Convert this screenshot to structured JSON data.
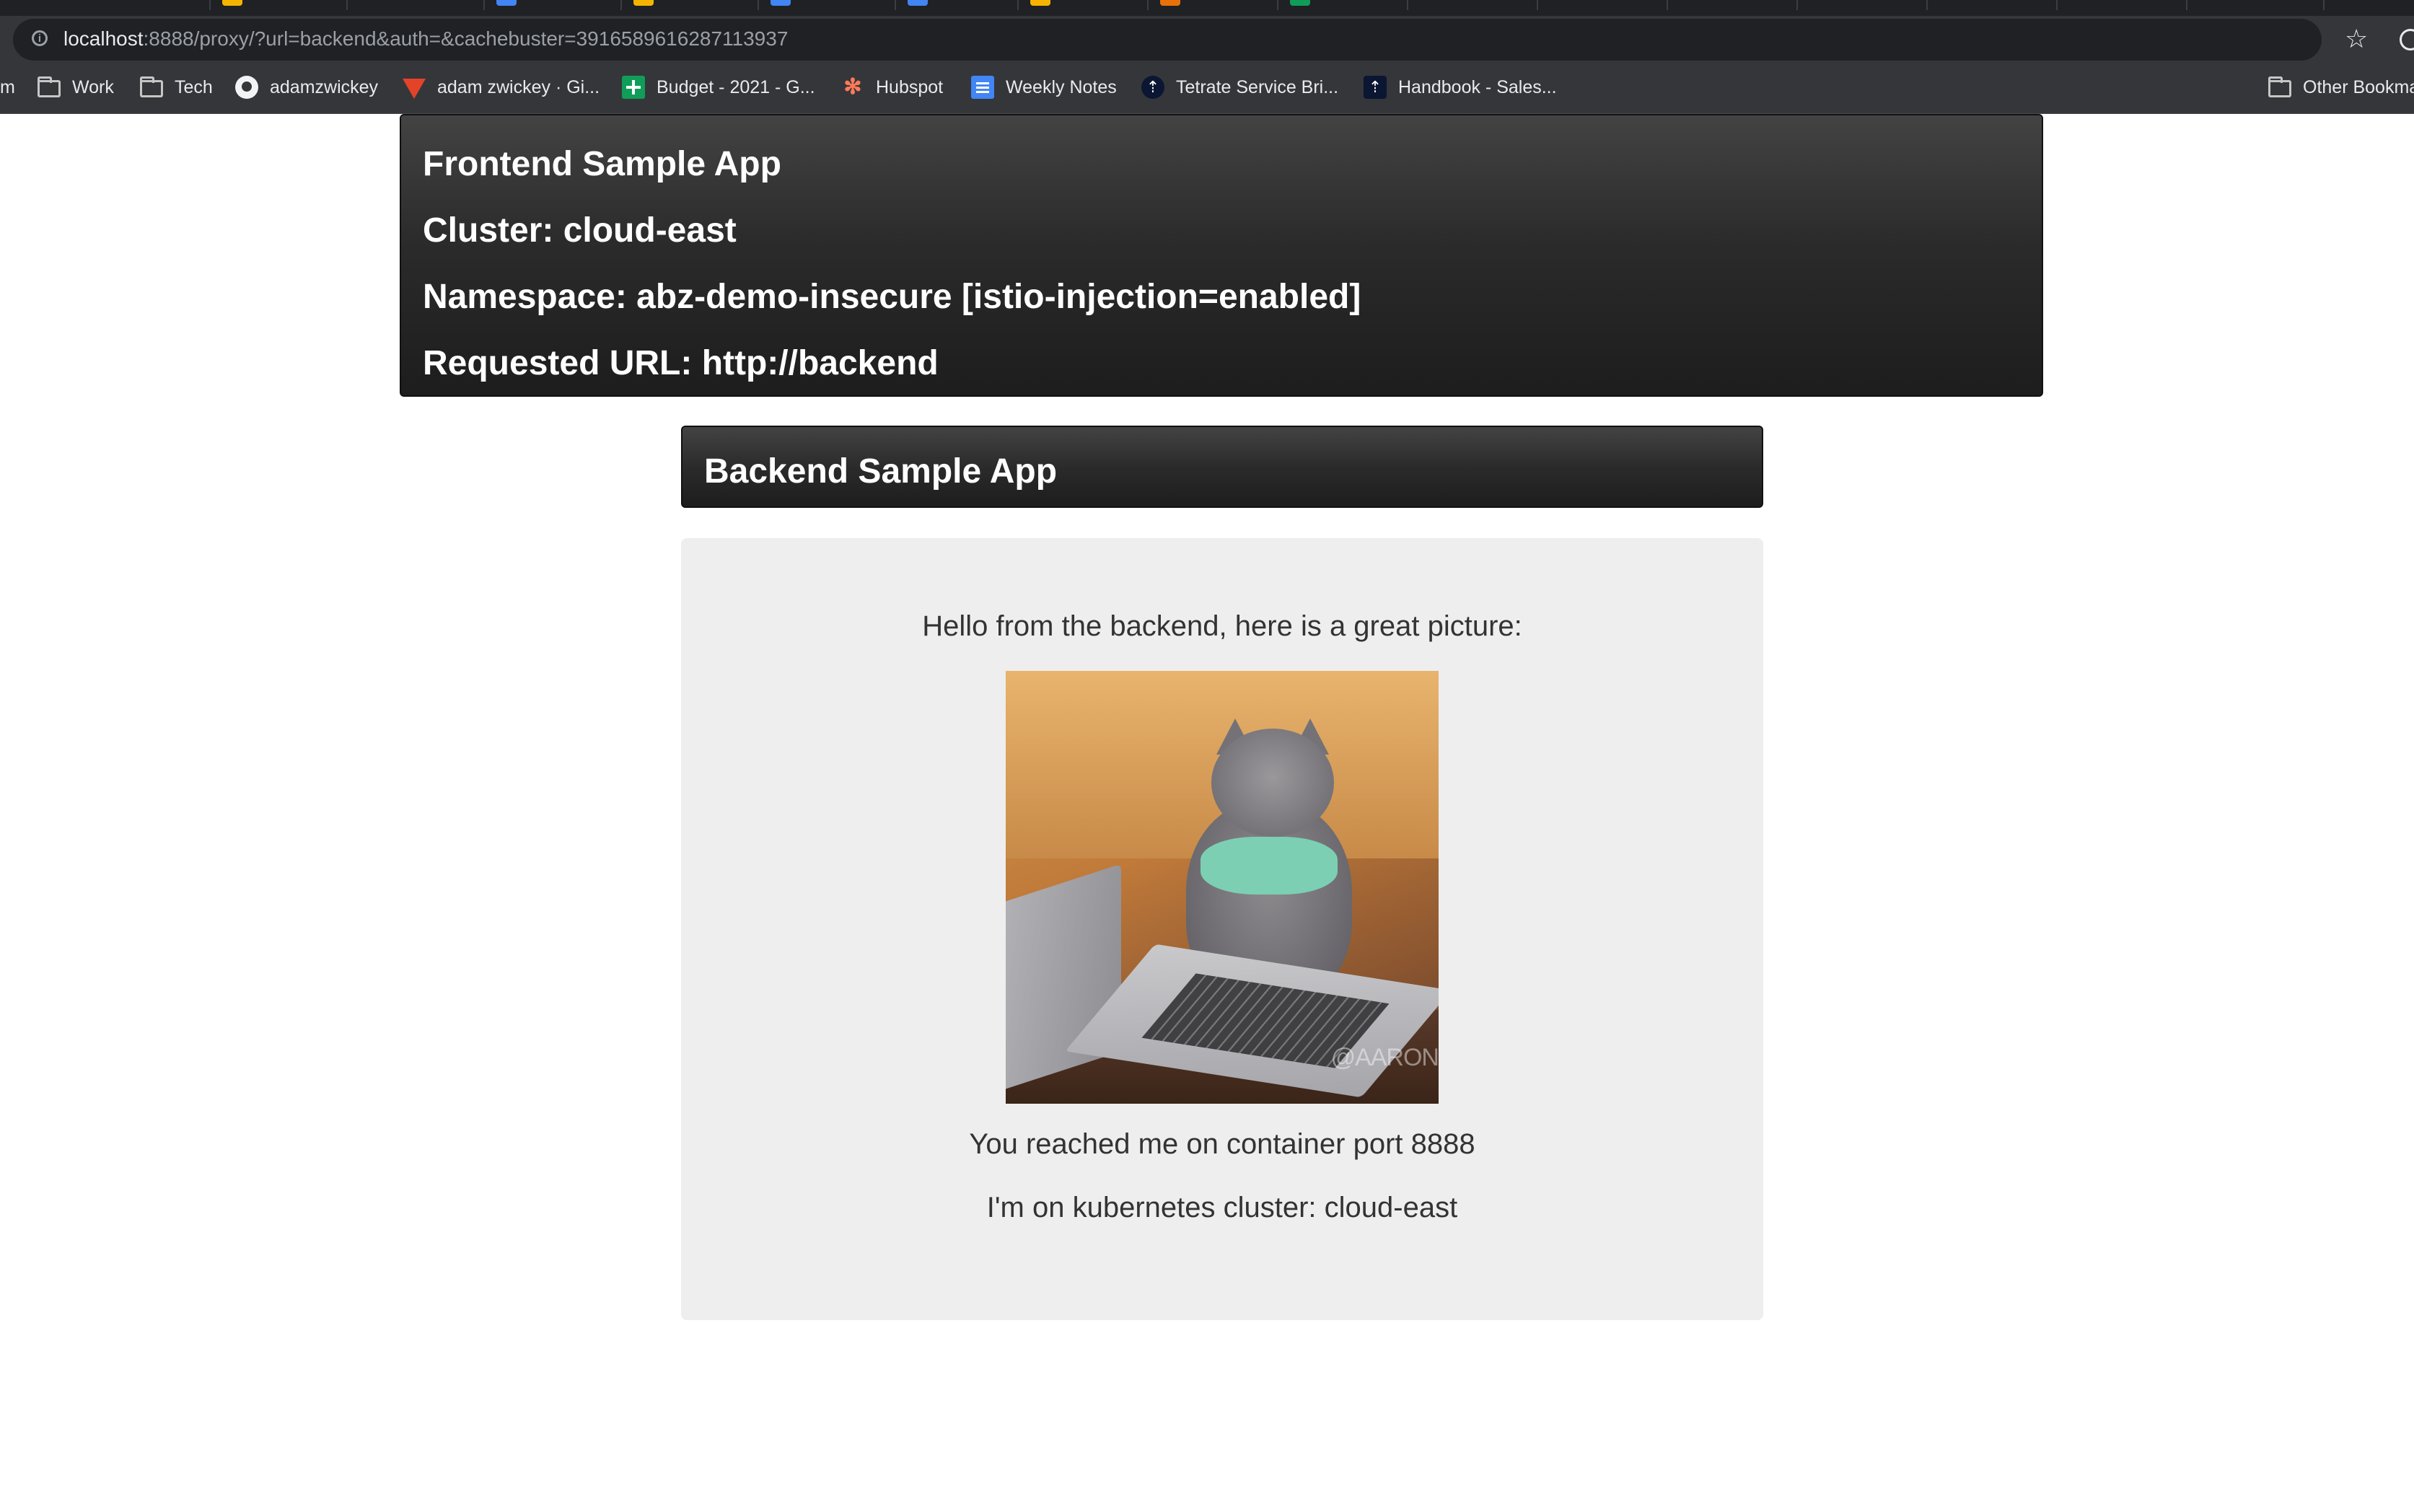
{
  "browser": {
    "url_host": "localhost",
    "url_rest": ":8888/proxy/?url=backend&auth=&cachebuster=3916589616287113937",
    "bookmarks": [
      {
        "label": "m",
        "icon": "none"
      },
      {
        "label": "Work",
        "icon": "folder-icon"
      },
      {
        "label": "Tech",
        "icon": "folder-icon"
      },
      {
        "label": "adamzwickey",
        "icon": "github-icon"
      },
      {
        "label": "adam zwickey · Gi...",
        "icon": "gitlab-icon"
      },
      {
        "label": "Budget - 2021 - G...",
        "icon": "sheets-icon"
      },
      {
        "label": "Hubspot",
        "icon": "hubspot-icon"
      },
      {
        "label": "Weekly Notes",
        "icon": "docs-icon"
      },
      {
        "label": "Tetrate Service Bri...",
        "icon": "tetrate-icon"
      },
      {
        "label": "Handbook - Sales...",
        "icon": "handbook-icon"
      },
      {
        "label": "Other Bookma",
        "icon": "folder-icon"
      }
    ]
  },
  "frontend": {
    "title": "Frontend Sample App",
    "cluster": "Cluster: cloud-east",
    "namespace": "Namespace: abz-demo-insecure [istio-injection=enabled]",
    "requested_url": "Requested URL: http://backend"
  },
  "backend": {
    "title": "Backend Sample App",
    "greeting": "Hello from the backend, here is a great picture:",
    "picture_watermark": "@AARON",
    "port_message": "You reached me on container port 8888",
    "cluster_message": "I'm on kubernetes cluster: cloud-east"
  },
  "colors": {
    "header_dark": "#2b2b2b",
    "card_bg": "#eeeeee",
    "browser_chrome": "#35363a"
  }
}
